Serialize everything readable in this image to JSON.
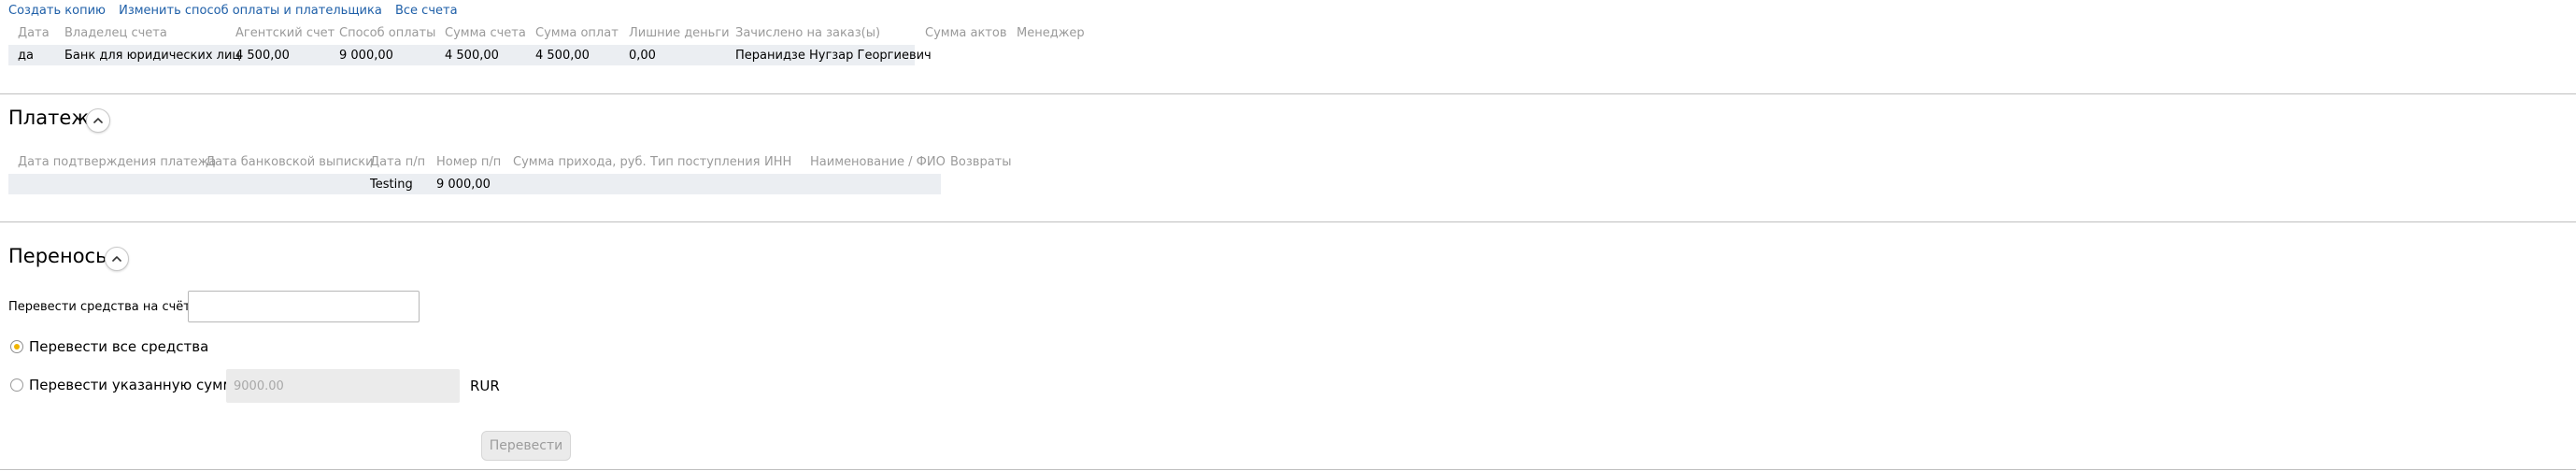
{
  "top_links": [
    "Создать копию",
    "Изменить способ оплаты и плательщика",
    "Все счета"
  ],
  "invoices": {
    "columns": [
      "Дата",
      "Владелец счета",
      "Агентский счет",
      "Способ оплаты",
      "Сумма счета",
      "Сумма оплат",
      "Лишние деньги",
      "Зачислено на заказ(ы)",
      "Сумма актов",
      "Менеджер"
    ],
    "row": [
      "да",
      "Банк для юридических лиц",
      "4 500,00",
      "9 000,00",
      "4 500,00",
      "4 500,00",
      "0,00",
      "Перанидзе Нугзар Георгиевич"
    ]
  },
  "payments": {
    "title": "Платежи",
    "columns": [
      "Дата подтверждения платежа",
      "Дата банковской выписки",
      "Дата п/п",
      "Номер п/п",
      "Сумма прихода, руб.",
      "Тип поступления",
      "ИНН",
      "Наименование / ФИО",
      "Возвраты"
    ],
    "row": {
      "date_pp": "Testing",
      "number_pp": "9 000,00"
    }
  },
  "transfers": {
    "title": "Переносы",
    "account_label": "Перевести средства на счёт",
    "account_value": "",
    "option_all": "Перевести все средства",
    "option_all_selected": true,
    "option_amount": "Перевести указанную сумму",
    "amount_placeholder": "9000.00",
    "currency": "RUR",
    "submit_label": "Перевести"
  },
  "icons": {
    "collapse": "chevron-up-icon"
  },
  "colors": {
    "link": "#1e5fa8",
    "radio_selected": "#f0b400",
    "row_band": "#ebeef2"
  }
}
